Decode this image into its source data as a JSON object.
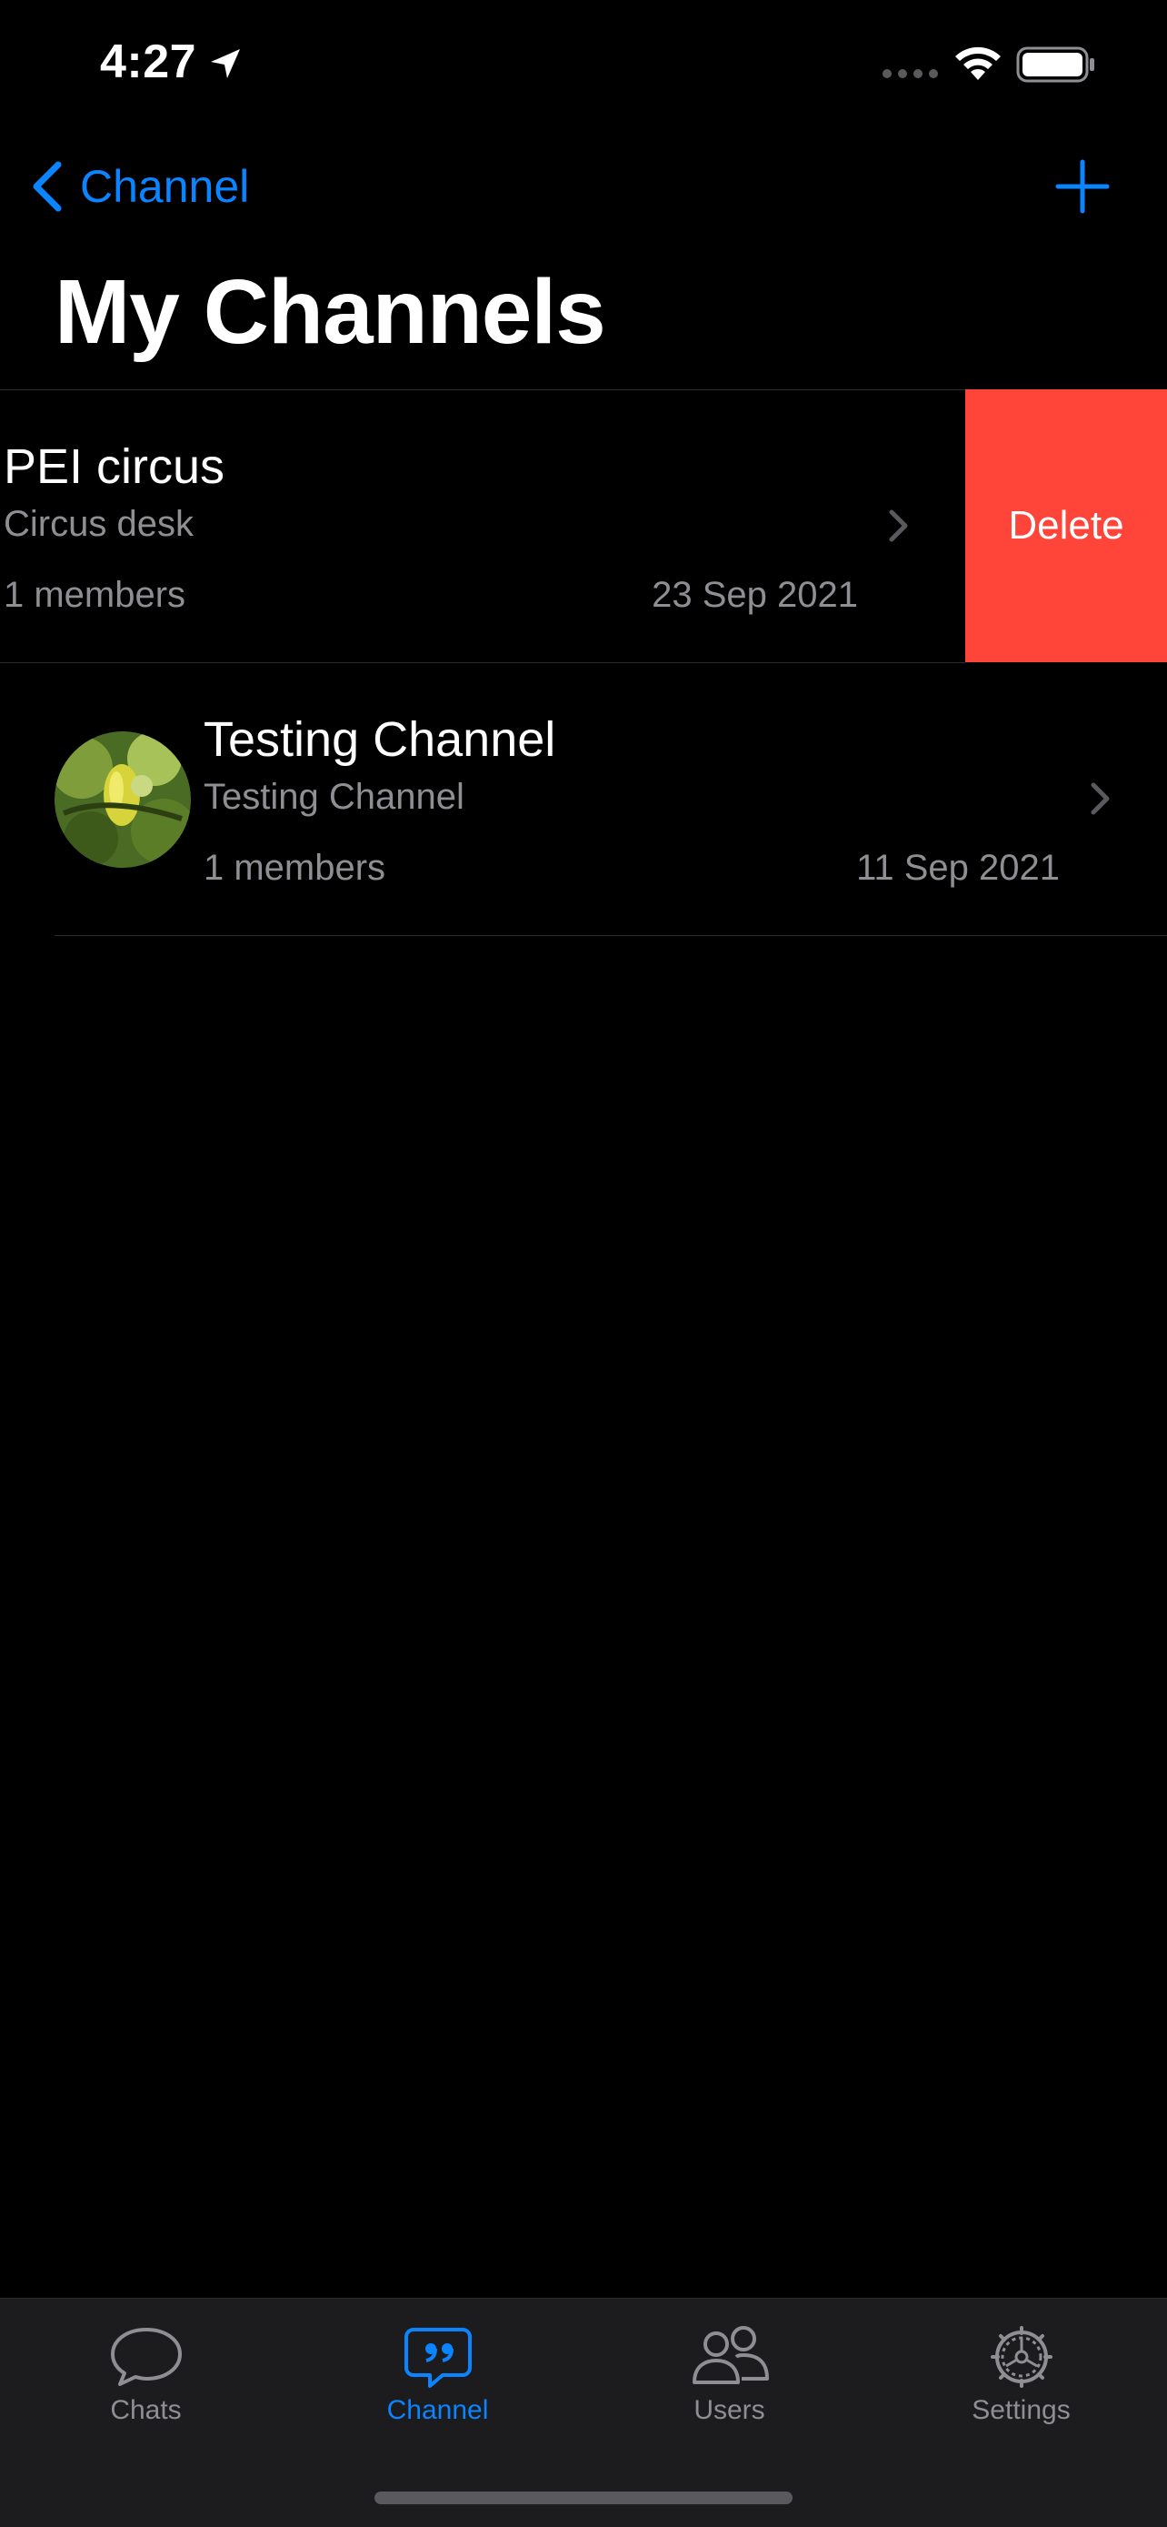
{
  "status_bar": {
    "time": "4:27"
  },
  "nav": {
    "back_label": "Channel",
    "title": "My Channels"
  },
  "channels": [
    {
      "title": "PEI circus",
      "subtitle": "Circus desk",
      "members": "1 members",
      "date": "23 Sep 2021",
      "swiped": true
    },
    {
      "title": "Testing Channel",
      "subtitle": "Testing Channel",
      "members": "1 members",
      "date": "11 Sep 2021",
      "swiped": false
    }
  ],
  "swipe_action": {
    "label": "Delete"
  },
  "tabs": [
    {
      "label": "Chats",
      "icon": "chat-bubble-icon",
      "active": false
    },
    {
      "label": "Channel",
      "icon": "channel-quote-icon",
      "active": true
    },
    {
      "label": "Users",
      "icon": "users-icon",
      "active": false
    },
    {
      "label": "Settings",
      "icon": "gear-icon",
      "active": false
    }
  ],
  "colors": {
    "accent": "#0a84ff",
    "delete": "#ff453a",
    "background": "#000000",
    "tab_bar": "#1c1c1e",
    "secondary_text": "#8e8e93"
  }
}
